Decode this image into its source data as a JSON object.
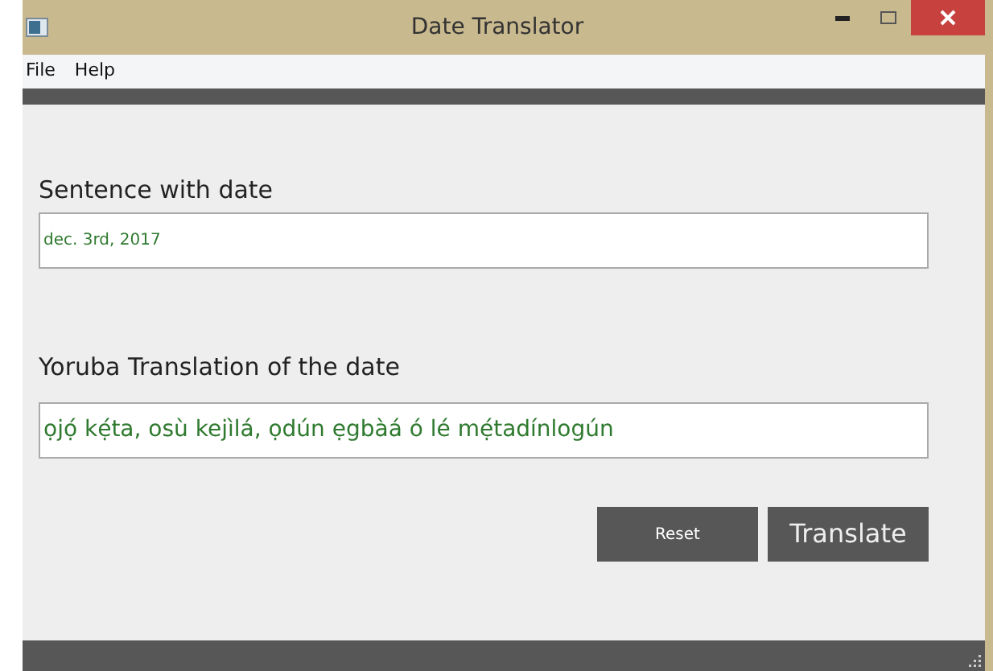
{
  "window": {
    "title": "Date Translator"
  },
  "menu": [
    "File",
    "Help"
  ],
  "source": {
    "label": "Sentence with date",
    "value": "dec. 3rd, 2017"
  },
  "translation": {
    "label": "Yoruba Translation of the date",
    "value": "ọjọ́ kẹ́ta, osù kejìlá, ọdún ẹgbàá ó lé mẹ́tadínlogún"
  },
  "buttons": [
    "Reset",
    "Translate"
  ]
}
